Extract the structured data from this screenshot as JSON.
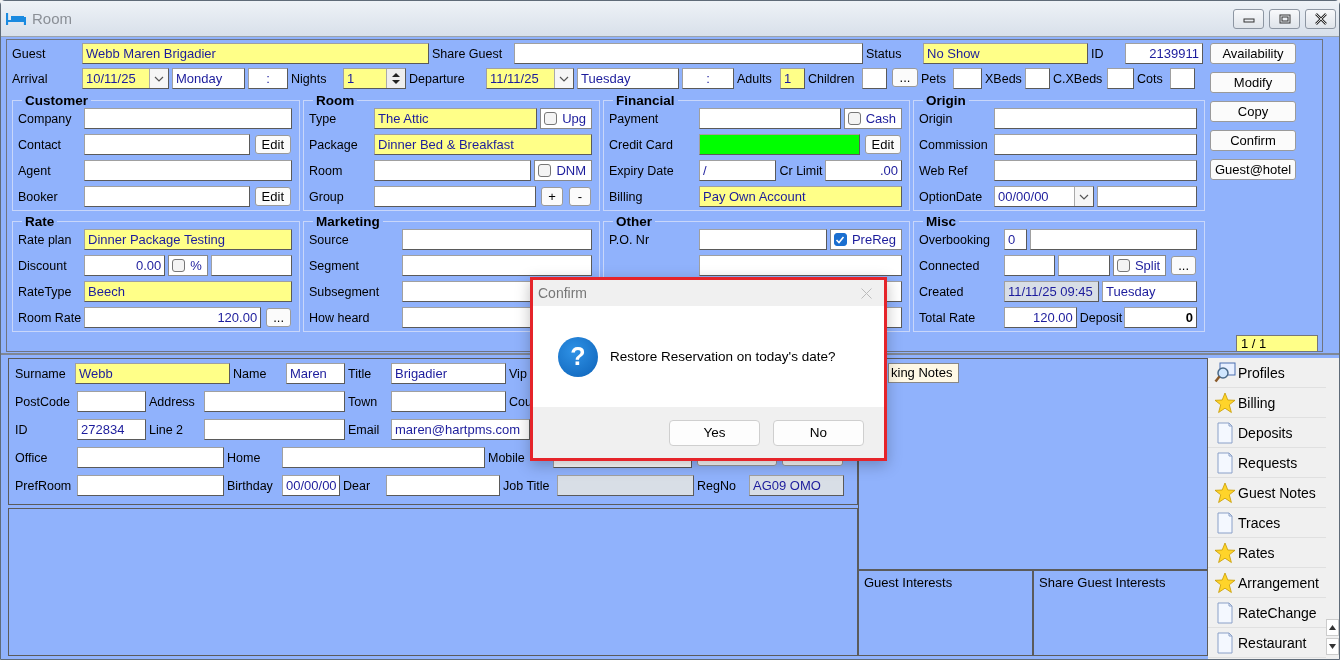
{
  "window": {
    "title": "Room"
  },
  "header": {
    "lines": [
      {
        "items": [
          {
            "kind": "label",
            "text": "Guest"
          },
          {
            "kind": "field",
            "value": "Webb Maren Brigadier",
            "highlighted": true
          },
          {
            "kind": "label",
            "text": "Share Guest"
          },
          {
            "kind": "field",
            "highlighted": false
          },
          {
            "kind": "label",
            "text": "Status"
          },
          {
            "kind": "field",
            "value": "No Show",
            "highlighted": true
          },
          {
            "kind": "label",
            "text": "ID"
          },
          {
            "kind": "number",
            "value": "2139911",
            "highlighted": false
          }
        ]
      },
      {
        "items": [
          {
            "kind": "label",
            "text": "Arrival"
          },
          {
            "kind": "date",
            "value": "10/11/25",
            "highlighted": true
          },
          {
            "kind": "field",
            "value": "Monday",
            "highlighted": false
          },
          {
            "kind": "time",
            "value": ":",
            "highlighted": false
          },
          {
            "kind": "label",
            "text": "Nights"
          },
          {
            "kind": "spin",
            "value": "1",
            "highlighted": true
          },
          {
            "kind": "label",
            "text": "Departure"
          },
          {
            "kind": "date",
            "value": "11/11/25",
            "highlighted": true
          },
          {
            "kind": "field",
            "value": "Tuesday",
            "highlighted": false
          },
          {
            "kind": "time",
            "value": ":",
            "highlighted": false
          },
          {
            "kind": "label",
            "text": "Adults"
          },
          {
            "kind": "small",
            "value": "1",
            "highlighted": true
          },
          {
            "kind": "label",
            "text": "Children"
          },
          {
            "kind": "small",
            "highlighted": false
          },
          {
            "kind": "button",
            "text": "..."
          },
          {
            "kind": "label",
            "text": "Pets"
          },
          {
            "kind": "small",
            "highlighted": false
          },
          {
            "kind": "label",
            "text": "XBeds"
          },
          {
            "kind": "small",
            "highlighted": false
          },
          {
            "kind": "label",
            "text": "C.XBeds"
          },
          {
            "kind": "small",
            "highlighted": false
          },
          {
            "kind": "label",
            "text": "Cots"
          },
          {
            "kind": "small",
            "highlighted": false
          }
        ]
      }
    ]
  },
  "groups": [
    {
      "title": "Customer",
      "lines": [
        {
          "items": [
            {
              "kind": "label",
              "text": "Company"
            },
            {
              "kind": "field",
              "highlighted": false
            }
          ]
        },
        {
          "items": [
            {
              "kind": "label",
              "text": "Contact"
            },
            {
              "kind": "field",
              "highlighted": false
            },
            {
              "kind": "button",
              "text": "Edit"
            }
          ]
        },
        {
          "items": [
            {
              "kind": "label",
              "text": "Agent"
            },
            {
              "kind": "field",
              "highlighted": false
            }
          ]
        },
        {
          "items": [
            {
              "kind": "label",
              "text": "Booker"
            },
            {
              "kind": "field",
              "highlighted": false
            },
            {
              "kind": "button",
              "text": "Edit"
            }
          ]
        }
      ]
    },
    {
      "title": "Room",
      "lines": [
        {
          "items": [
            {
              "kind": "label",
              "text": "Type"
            },
            {
              "kind": "field",
              "value": "The Attic",
              "highlighted": true
            },
            {
              "kind": "check",
              "label": "Upg",
              "checked": false
            }
          ]
        },
        {
          "items": [
            {
              "kind": "label",
              "text": "Package"
            },
            {
              "kind": "field",
              "value": "Dinner Bed & Breakfast",
              "highlighted": true
            }
          ]
        },
        {
          "items": [
            {
              "kind": "label",
              "text": "Room"
            },
            {
              "kind": "field",
              "highlighted": false
            },
            {
              "kind": "check",
              "label": "DNM",
              "checked": false
            }
          ]
        },
        {
          "items": [
            {
              "kind": "label",
              "text": "Group"
            },
            {
              "kind": "field",
              "highlighted": false
            },
            {
              "kind": "button",
              "text": "+"
            },
            {
              "kind": "button",
              "text": "-"
            }
          ]
        }
      ]
    },
    {
      "title": "Financial",
      "lines": [
        {
          "items": [
            {
              "kind": "label",
              "text": "Payment"
            },
            {
              "kind": "field",
              "highlighted": false
            },
            {
              "kind": "check",
              "label": "Cash",
              "checked": false
            }
          ]
        },
        {
          "items": [
            {
              "kind": "label",
              "text": "Credit Card"
            },
            {
              "kind": "field",
              "color": "#00ff00"
            },
            {
              "kind": "button",
              "text": "Edit"
            }
          ]
        },
        {
          "items": [
            {
              "kind": "label",
              "text": "Expiry Date"
            },
            {
              "kind": "field",
              "value": "/",
              "highlighted": false
            },
            {
              "kind": "label",
              "text": "Cr Limit"
            },
            {
              "kind": "number",
              "value": ".00",
              "highlighted": false
            }
          ]
        },
        {
          "items": [
            {
              "kind": "label",
              "text": "Billing"
            },
            {
              "kind": "field",
              "value": "Pay Own Account",
              "highlighted": true
            }
          ]
        }
      ]
    },
    {
      "title": "Origin",
      "lines": [
        {
          "items": [
            {
              "kind": "label",
              "text": "Origin"
            },
            {
              "kind": "field",
              "highlighted": false
            }
          ]
        },
        {
          "items": [
            {
              "kind": "label",
              "text": "Commission"
            },
            {
              "kind": "field",
              "highlighted": false
            }
          ]
        },
        {
          "items": [
            {
              "kind": "label",
              "text": "Web Ref"
            },
            {
              "kind": "field",
              "highlighted": false
            }
          ]
        },
        {
          "items": [
            {
              "kind": "label",
              "text": "OptionDate"
            },
            {
              "kind": "date",
              "value": "00/00/00",
              "highlighted": false
            },
            {
              "kind": "field",
              "highlighted": false
            }
          ]
        }
      ]
    },
    {
      "title": "Rate",
      "lines": [
        {
          "items": [
            {
              "kind": "label",
              "text": "Rate plan"
            },
            {
              "kind": "field",
              "value": "Dinner Package Testing",
              "highlighted": true
            }
          ]
        },
        {
          "items": [
            {
              "kind": "label",
              "text": "Discount"
            },
            {
              "kind": "number",
              "value": "0.00",
              "highlighted": false
            },
            {
              "kind": "check",
              "label": "%",
              "checked": false
            },
            {
              "kind": "field",
              "highlighted": false
            }
          ]
        },
        {
          "items": [
            {
              "kind": "label",
              "text": "RateType"
            },
            {
              "kind": "field",
              "value": "Beech",
              "highlighted": true
            }
          ]
        },
        {
          "items": [
            {
              "kind": "label",
              "text": "Room Rate"
            },
            {
              "kind": "number",
              "value": "120.00",
              "highlighted": false
            },
            {
              "kind": "button",
              "text": "..."
            }
          ]
        }
      ]
    },
    {
      "title": "Marketing",
      "lines": [
        {
          "items": [
            {
              "kind": "label",
              "text": "Source"
            },
            {
              "kind": "field",
              "highlighted": false
            }
          ]
        },
        {
          "items": [
            {
              "kind": "label",
              "text": "Segment"
            },
            {
              "kind": "field",
              "highlighted": false
            }
          ]
        },
        {
          "items": [
            {
              "kind": "label",
              "text": "Subsegment"
            },
            {
              "kind": "field",
              "highlighted": false
            }
          ]
        },
        {
          "items": [
            {
              "kind": "label",
              "text": "How heard"
            },
            {
              "kind": "field",
              "highlighted": false
            }
          ]
        }
      ]
    },
    {
      "title": "Other",
      "lines": [
        {
          "items": [
            {
              "kind": "label",
              "text": "P.O. Nr"
            },
            {
              "kind": "field",
              "highlighted": false
            },
            {
              "kind": "check",
              "label": "PreReg",
              "checked": true
            }
          ]
        },
        {
          "items": [
            {
              "kind": "field",
              "highlighted": false
            }
          ]
        },
        {
          "items": [
            {
              "kind": "field",
              "highlighted": false
            }
          ]
        },
        {
          "items": [
            {
              "kind": "field",
              "highlighted": false
            }
          ]
        }
      ]
    },
    {
      "title": "Misc",
      "lines": [
        {
          "items": [
            {
              "kind": "label",
              "text": "Overbooking"
            },
            {
              "kind": "small",
              "value": "0",
              "highlighted": false
            },
            {
              "kind": "field",
              "highlighted": false
            }
          ]
        },
        {
          "items": [
            {
              "kind": "label",
              "text": "Connected"
            },
            {
              "kind": "field",
              "highlighted": false
            },
            {
              "kind": "field",
              "highlighted": false
            },
            {
              "kind": "check",
              "label": "Split",
              "checked": false
            },
            {
              "kind": "button",
              "text": "..."
            }
          ]
        },
        {
          "items": [
            {
              "kind": "label",
              "text": "Created"
            },
            {
              "kind": "readonly",
              "value": "11/11/25 09:45"
            },
            {
              "kind": "field",
              "value": "Tuesday",
              "highlighted": false
            }
          ]
        },
        {
          "items": [
            {
              "kind": "label",
              "text": "Total Rate"
            },
            {
              "kind": "number",
              "value": "120.00",
              "highlighted": false
            },
            {
              "kind": "label",
              "text": "Deposit"
            },
            {
              "kind": "total",
              "value": "0",
              "highlighted": false
            }
          ]
        }
      ]
    }
  ],
  "actions": [
    "Availability",
    "Modify",
    "Copy",
    "Confirm",
    "Guest@hotel"
  ],
  "pager": "1 / 1",
  "guest": {
    "lines": [
      {
        "items": [
          {
            "kind": "label",
            "text": "Surname"
          },
          {
            "kind": "field",
            "value": "Webb",
            "highlighted": true
          },
          {
            "kind": "label",
            "text": "Name"
          },
          {
            "kind": "field",
            "value": "Maren",
            "highlighted": false
          },
          {
            "kind": "label",
            "text": "Title"
          },
          {
            "kind": "field",
            "value": "Brigadier",
            "highlighted": false
          },
          {
            "kind": "label",
            "text": "Vip"
          }
        ]
      },
      {
        "items": [
          {
            "kind": "label",
            "text": "PostCode"
          },
          {
            "kind": "field",
            "highlighted": false
          },
          {
            "kind": "label",
            "text": "Address"
          },
          {
            "kind": "field",
            "highlighted": false
          },
          {
            "kind": "label",
            "text": "Town"
          },
          {
            "kind": "field",
            "highlighted": false
          },
          {
            "kind": "label",
            "text": "Cou"
          }
        ]
      },
      {
        "items": [
          {
            "kind": "label",
            "text": "ID"
          },
          {
            "kind": "field",
            "value": "272834",
            "highlighted": false
          },
          {
            "kind": "label",
            "text": "Line 2"
          },
          {
            "kind": "field",
            "highlighted": false
          },
          {
            "kind": "label",
            "text": "Email"
          },
          {
            "kind": "field",
            "value": "maren@hartpms.com",
            "highlighted": false
          }
        ]
      },
      {
        "items": [
          {
            "kind": "label",
            "text": "Office"
          },
          {
            "kind": "field",
            "highlighted": false
          },
          {
            "kind": "label",
            "text": "Home"
          },
          {
            "kind": "field",
            "highlighted": false
          },
          {
            "kind": "label",
            "text": "Mobile"
          },
          {
            "kind": "field",
            "highlighted": false
          },
          {
            "kind": "button"
          },
          {
            "kind": "button"
          }
        ]
      },
      {
        "items": [
          {
            "kind": "label",
            "text": "PrefRoom"
          },
          {
            "kind": "field",
            "highlighted": false
          },
          {
            "kind": "label",
            "text": "Birthday"
          },
          {
            "kind": "field",
            "value": "00/00/00",
            "highlighted": false
          },
          {
            "kind": "label",
            "text": "Dear"
          },
          {
            "kind": "field",
            "highlighted": false
          },
          {
            "kind": "label",
            "text": "Job Title"
          },
          {
            "kind": "readonly"
          },
          {
            "kind": "label",
            "text": "RegNo"
          },
          {
            "kind": "readonly",
            "value": "AG09 OMO"
          }
        ]
      }
    ]
  },
  "notes": {
    "tab": "king Notes"
  },
  "interests": [
    "Guest Interests",
    "Share Guest Interests"
  ],
  "sidebar": {
    "items": [
      {
        "label": "Profiles",
        "kind": "search"
      },
      {
        "label": "Billing",
        "kind": "star"
      },
      {
        "label": "Deposits",
        "kind": "page"
      },
      {
        "label": "Requests",
        "kind": "page"
      },
      {
        "label": "Guest Notes",
        "kind": "star"
      },
      {
        "label": "Traces",
        "kind": "page"
      },
      {
        "label": "Rates",
        "kind": "star"
      },
      {
        "label": "Arrangement",
        "kind": "star"
      },
      {
        "label": "RateChange",
        "kind": "page"
      },
      {
        "label": "Restaurant",
        "kind": "page"
      }
    ]
  },
  "dialog": {
    "title": "Confirm",
    "icon": "?",
    "message": "Restore Reservation on today's date?",
    "buttons": [
      "Yes",
      "No"
    ]
  }
}
